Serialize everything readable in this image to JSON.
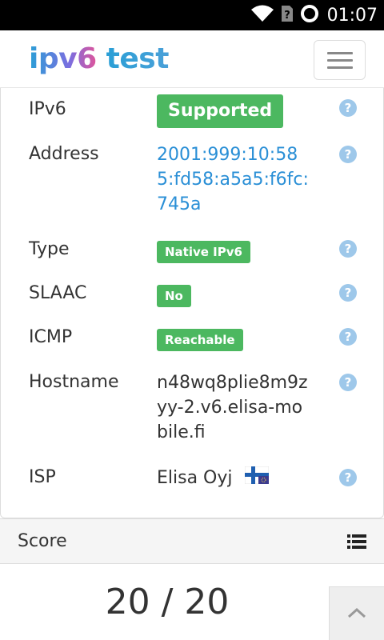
{
  "status_bar": {
    "time": "01:07",
    "icons": [
      "wifi-icon",
      "no-sim-icon",
      "loading-ring-icon"
    ]
  },
  "navbar": {
    "brand_part1": "ipv6",
    "brand_part2": "test",
    "menu_icon": "hamburger-menu-icon"
  },
  "results": [
    {
      "label": "IPv6",
      "value": "Supported",
      "kind": "badge-big"
    },
    {
      "label": "Address",
      "value": "2001:999:10:585:fd58:a5a5:f6fc:745a",
      "kind": "link"
    },
    {
      "label": "Type",
      "value": "Native IPv6",
      "kind": "badge-small"
    },
    {
      "label": "SLAAC",
      "value": "No",
      "kind": "badge-small"
    },
    {
      "label": "ICMP",
      "value": "Reachable",
      "kind": "badge-small"
    },
    {
      "label": "Hostname",
      "value": "n48wq8plie8m9zyy-2.v6.elisa-mobile.fi",
      "kind": "text"
    },
    {
      "label": "ISP",
      "value": "Elisa Oyj",
      "kind": "text",
      "flag": "finland-eu-flag-icon"
    }
  ],
  "help_icon": "question-mark-icon",
  "help_glyph": "?",
  "score": {
    "title": "Score",
    "value": "20 / 20",
    "list_icon": "list-icon",
    "scroll_icon": "chevron-up-icon"
  },
  "colors": {
    "badge_green": "#4cb860",
    "link_blue": "#2a8fd6",
    "help_blue": "#9ec8ea"
  }
}
